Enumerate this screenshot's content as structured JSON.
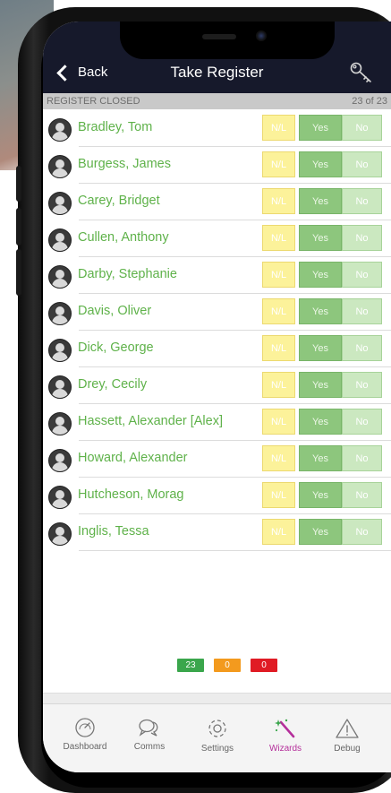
{
  "header": {
    "back_label": "Back",
    "title": "Take Register"
  },
  "status": {
    "left": "REGISTER CLOSED",
    "right": "23 of 23"
  },
  "buttons": {
    "nl": "N/L",
    "yes": "Yes",
    "no": "No"
  },
  "students": [
    "Bradley, Tom",
    "Burgess, James",
    "Carey, Bridget",
    "Cullen, Anthony",
    "Darby, Stephanie",
    "Davis, Oliver",
    "Dick, George",
    "Drey, Cecily",
    "Hassett, Alexander [Alex]",
    "Howard, Alexander",
    "Hutcheson, Morag",
    "Inglis, Tessa"
  ],
  "counts": [
    {
      "value": "23",
      "color": "#3aa64c"
    },
    {
      "value": "0",
      "color": "#f39a1e"
    },
    {
      "value": "0",
      "color": "#e01b24"
    }
  ],
  "tabs": [
    {
      "label": "Dashboard",
      "icon": "dashboard-gauge-icon"
    },
    {
      "label": "Comms",
      "icon": "chat-bubbles-icon"
    },
    {
      "label": "Settings",
      "icon": "gear-icon"
    },
    {
      "label": "Wizards",
      "icon": "magic-wand-icon"
    },
    {
      "label": "Debug",
      "icon": "warning-triangle-icon"
    }
  ],
  "colors": {
    "nav_bg": "#16192b",
    "name_green": "#5fb24a",
    "active_tab": "#b52f9b"
  }
}
